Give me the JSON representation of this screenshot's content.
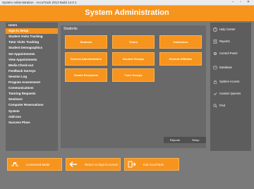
{
  "window": {
    "title": "System Administration - AccuTrack 2013 Build 14.0.1",
    "min": "–",
    "max": "▫",
    "close": "✕"
  },
  "header": {
    "title": "System Administration"
  },
  "sidebar": {
    "items": [
      "Users",
      "Sign-in Setup",
      "Student Visits Tracking",
      "Tutor Visits Tracking",
      "Student Demographics",
      "Set Appointments",
      "View Appointments",
      "Media Check-out",
      "Feedback Surveys",
      "Session Log",
      "Program Assessment",
      "Communications",
      "Tutoring Requests",
      "Seminars",
      "Computer Reservations",
      "System",
      "Add-ons",
      "Success Plans"
    ]
  },
  "main": {
    "section_label": "Students",
    "tiles": [
      "Students",
      "Tutors",
      "Instructors",
      "Student Administrators",
      "Student Groups",
      "Student Affiliates",
      "Grants Recipients",
      "Tutor Groups"
    ],
    "reports_label": "Reports",
    "setup_label": "Setup"
  },
  "right_panel": {
    "items": [
      {
        "label": "Help Center",
        "icon": "help-icon"
      },
      {
        "label": "Reports",
        "icon": "reports-icon"
      },
      {
        "label": "Control Panel",
        "icon": "control-panel-icon"
      },
      {
        "label": "Database",
        "icon": "database-icon"
      },
      {
        "label": "System Access",
        "icon": "system-access-icon"
      },
      {
        "label": "Custom Queries",
        "icon": "custom-queries-icon"
      },
      {
        "label": "Find",
        "icon": "find-icon"
      }
    ]
  },
  "bottom": {
    "buttons": [
      {
        "label": "Connected Mode",
        "icon": "connected-icon"
      },
      {
        "label": "Return to Sign-in screen",
        "icon": "back-arrow-icon"
      },
      {
        "label": "Exit AccuTrack",
        "icon": "exit-icon"
      }
    ]
  },
  "colors": {
    "accent": "#f7941d",
    "background": "#7a7a7a",
    "panel": "#696969"
  }
}
